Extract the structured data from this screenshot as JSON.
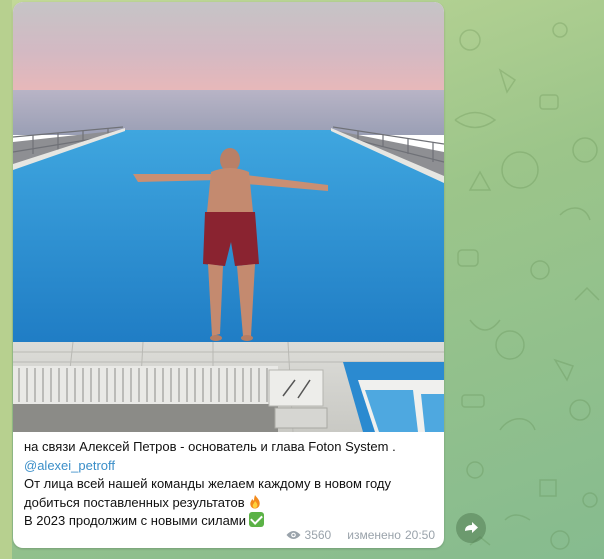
{
  "post": {
    "line1": "на связи Алексей Петров - основатель и глава Foton System .",
    "mention": "@alexei_petroff",
    "line3": "От лица всей нашей команды желаем каждому в новом году добиться поставленных результатов",
    "line4": "В 2023 продолжим с новыми силами",
    "views": "3560",
    "edited_label": "изменено",
    "time": "20:50"
  },
  "media": {
    "type": "video-preview",
    "subject": "man-jumping-into-infinity-pool"
  },
  "icons": {
    "views": "eye-icon",
    "forward": "share-arrow-icon",
    "emoji1": "fire-emoji",
    "emoji2": "check-mark-emoji"
  },
  "colors": {
    "chat_background": "#9cc58a",
    "bubble": "#ffffff",
    "link": "#3a8ec8",
    "meta_text": "#9aa3ab"
  }
}
